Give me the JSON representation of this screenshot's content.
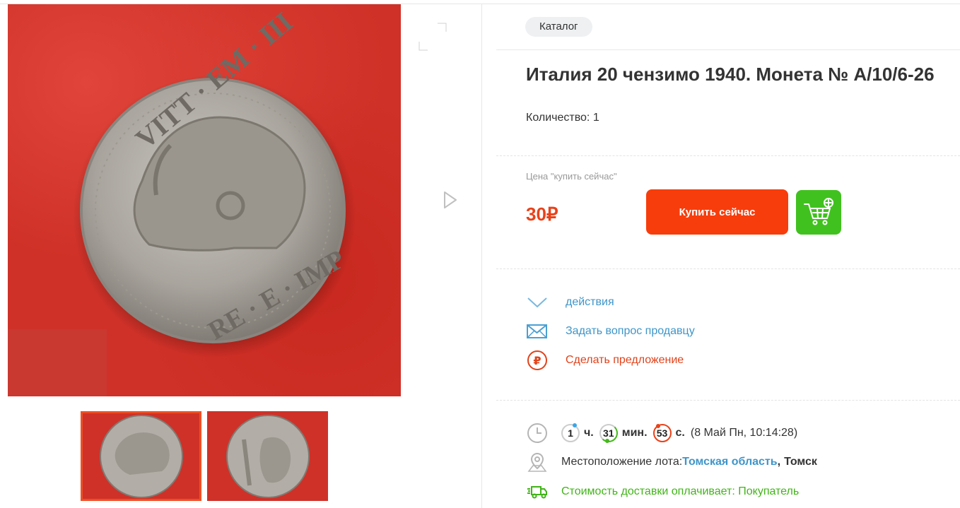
{
  "catalog_label": "Каталог",
  "lot": {
    "title": "Италия 20 чензимо 1940. Монета № А/10/6-26",
    "quantity": "Количество: 1",
    "price_label": "Цена \"купить сейчас\"",
    "price": "30₽",
    "buy_now_label": "Купить сейчас"
  },
  "coin_front_legend": {
    "top": "VITT · EM · III",
    "right": "RE · E · IMP"
  },
  "actions": [
    {
      "label": "действия",
      "icon": "chevron-down-icon"
    },
    {
      "label": "Задать вопрос продавцу",
      "icon": "envelope-icon"
    },
    {
      "label": "Сделать предложение",
      "icon": "ruble-icon"
    }
  ],
  "timer": {
    "hours": "1",
    "hours_unit": "ч.",
    "minutes": "31",
    "minutes_unit": "мин.",
    "seconds": "53",
    "seconds_unit": "с.",
    "end_time": "(8 Май Пн, 10:14:28)"
  },
  "location": {
    "label": "Местоположение лота:",
    "region": "Томская область",
    "separator": ",",
    "city": "Томск"
  },
  "delivery": "Стоимость доставки оплачивает: Покупатель",
  "colors": {
    "accent_red": "#f83d0c",
    "price_red": "#e8421a",
    "green": "#41c11f",
    "link_blue": "#3e95c9"
  }
}
